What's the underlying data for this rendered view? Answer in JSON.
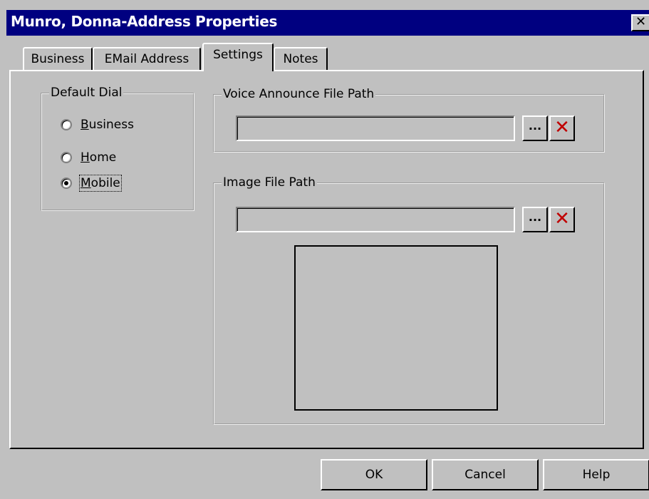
{
  "window": {
    "title": "Munro, Donna-Address Properties",
    "close_label": "✕"
  },
  "tabs": [
    {
      "label": "Business",
      "active": false
    },
    {
      "label": "EMail Address",
      "active": false
    },
    {
      "label": "Settings",
      "active": true
    },
    {
      "label": "Notes",
      "active": false
    }
  ],
  "default_dial": {
    "legend": "Default Dial",
    "options": [
      {
        "hotkey": "B",
        "rest": "usiness",
        "checked": false
      },
      {
        "hotkey": "H",
        "rest": "ome",
        "checked": false
      },
      {
        "hotkey": "M",
        "rest": "obile",
        "checked": true
      }
    ]
  },
  "voice_announce": {
    "legend": "Voice Announce File Path",
    "value": "",
    "browse_label": "...",
    "clear_label": "✕"
  },
  "image_file": {
    "legend": "Image File Path",
    "value": "",
    "browse_label": "...",
    "clear_label": "✕"
  },
  "buttons": {
    "ok": "OK",
    "cancel": "Cancel",
    "help": "Help"
  },
  "colors": {
    "title_bar": "#000080",
    "face": "#c0c0c0",
    "clear_icon": "#c00000"
  }
}
